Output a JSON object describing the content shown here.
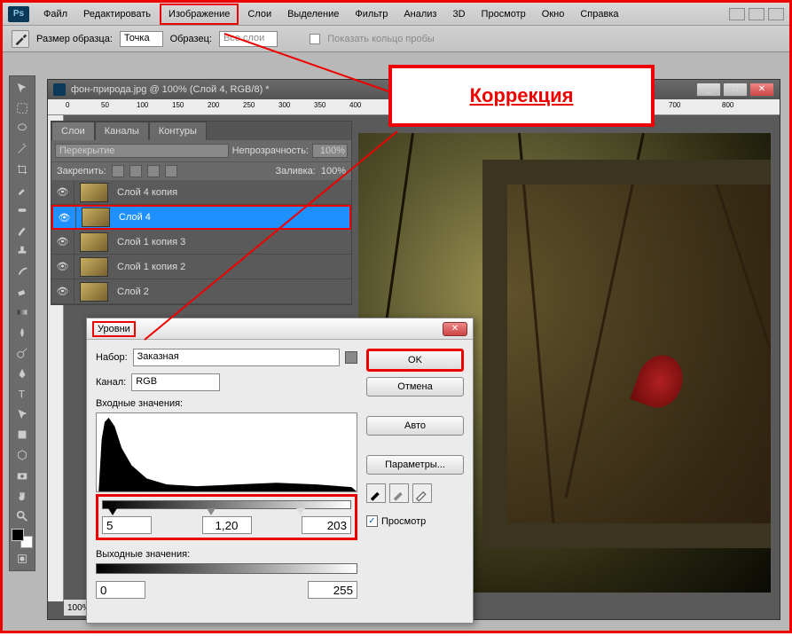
{
  "app_logo": "Ps",
  "menu": [
    "Файл",
    "Редактировать",
    "Изображение",
    "Слои",
    "Выделение",
    "Фильтр",
    "Анализ",
    "3D",
    "Просмотр",
    "Окно",
    "Справка"
  ],
  "menu_highlight_index": 2,
  "callout_label": "Коррекция",
  "options_bar": {
    "sample_size_label": "Размер образца:",
    "sample_size_value": "Точка",
    "sample_label": "Образец:",
    "sample_value": "Все слои",
    "ring_label": "Показать кольцо пробы"
  },
  "document": {
    "title": "фон-природа.jpg @ 100% (Слой 4, RGB/8) *",
    "ruler_marks": [
      "0",
      "50",
      "100",
      "150",
      "200",
      "250",
      "300",
      "350",
      "400",
      "700",
      "800"
    ],
    "zoom": "100%"
  },
  "layers_panel": {
    "tabs": [
      "Слои",
      "Каналы",
      "Контуры"
    ],
    "blend_mode": "Перекрытие",
    "opacity_label": "Непрозрачность:",
    "opacity_value": "100%",
    "lock_label": "Закрепить:",
    "fill_label": "Заливка:",
    "fill_value": "100%",
    "layers": [
      {
        "name": "Слой 4 копия",
        "selected": false
      },
      {
        "name": "Слой 4",
        "selected": true
      },
      {
        "name": "Слой 1 копия 3",
        "selected": false
      },
      {
        "name": "Слой 1 копия 2",
        "selected": false
      },
      {
        "name": "Слой 2",
        "selected": false
      }
    ]
  },
  "levels_dialog": {
    "title": "Уровни",
    "preset_label": "Набор:",
    "preset_value": "Заказная",
    "channel_label": "Канал:",
    "channel_value": "RGB",
    "input_label": "Входные значения:",
    "input_black": "5",
    "input_gamma": "1,20",
    "input_white": "203",
    "output_label": "Выходные значения:",
    "output_black": "0",
    "output_white": "255",
    "ok": "OK",
    "cancel": "Отмена",
    "auto": "Авто",
    "options": "Параметры...",
    "preview": "Просмотр",
    "preview_checked": "✓"
  }
}
